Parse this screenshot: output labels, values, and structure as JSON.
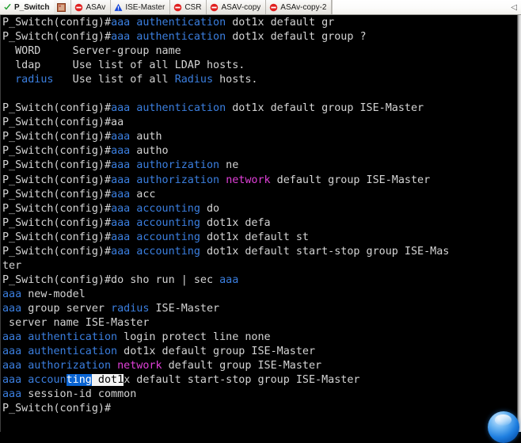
{
  "window": {
    "active_tab": "P_Switch",
    "hostname": "P_Switch",
    "prompt": "P_Switch(config)#"
  },
  "tabs": [
    {
      "label": "P_Switch",
      "icon": "green-check-icon",
      "active": true
    },
    {
      "label": "",
      "icon": "image-thumbnail-icon",
      "active": false
    },
    {
      "label": "ASAv",
      "icon": "red-stop-icon",
      "active": false
    },
    {
      "label": "ISE-Master",
      "icon": "blue-warning-icon",
      "active": false
    },
    {
      "label": "CSR",
      "icon": "red-stop-icon",
      "active": false
    },
    {
      "label": "ASAV-copy",
      "icon": "red-stop-icon",
      "active": false
    },
    {
      "label": "ASAv-copy-2",
      "icon": "red-stop-icon",
      "active": false
    }
  ],
  "tab_overflow_glyph": "◁",
  "colors": {
    "background": "#000000",
    "text": "#d4d4d4",
    "keyword_blue": "#3b7fe0",
    "keyword_magenta": "#e040d8",
    "selection_blue": "#0a64d2",
    "selection_white": "#f2f2f2",
    "tabbar_background": "#eceae6"
  },
  "terminal": {
    "lines": [
      {
        "id": "l01",
        "segs": [
          {
            "t": "P_Switch(config)#",
            "c": "w"
          },
          {
            "t": "aaa authentication",
            "c": "b"
          },
          {
            "t": " dot1x default gr",
            "c": "w"
          }
        ]
      },
      {
        "id": "l02",
        "segs": [
          {
            "t": "P_Switch(config)#",
            "c": "w"
          },
          {
            "t": "aaa authentication",
            "c": "b"
          },
          {
            "t": " dot1x default group ?",
            "c": "w"
          }
        ]
      },
      {
        "id": "l03",
        "segs": [
          {
            "t": "  WORD     Server-group name",
            "c": "w"
          }
        ]
      },
      {
        "id": "l04",
        "segs": [
          {
            "t": "  ldap     Use list of all LDAP hosts.",
            "c": "w"
          }
        ]
      },
      {
        "id": "l05",
        "segs": [
          {
            "t": "  ",
            "c": "w"
          },
          {
            "t": "radius",
            "c": "b"
          },
          {
            "t": "   Use list of all ",
            "c": "w"
          },
          {
            "t": "Radius",
            "c": "b"
          },
          {
            "t": " hosts.",
            "c": "w"
          }
        ]
      },
      {
        "id": "l06",
        "segs": [
          {
            "t": "",
            "c": "w"
          }
        ]
      },
      {
        "id": "l07",
        "segs": [
          {
            "t": "P_Switch(config)#",
            "c": "w"
          },
          {
            "t": "aaa authentication",
            "c": "b"
          },
          {
            "t": " dot1x default group ISE-Master",
            "c": "w"
          }
        ]
      },
      {
        "id": "l08",
        "segs": [
          {
            "t": "P_Switch(config)#aa",
            "c": "w"
          }
        ]
      },
      {
        "id": "l09",
        "segs": [
          {
            "t": "P_Switch(config)#",
            "c": "w"
          },
          {
            "t": "aaa",
            "c": "b"
          },
          {
            "t": " auth",
            "c": "w"
          }
        ]
      },
      {
        "id": "l10",
        "segs": [
          {
            "t": "P_Switch(config)#",
            "c": "w"
          },
          {
            "t": "aaa",
            "c": "b"
          },
          {
            "t": " autho",
            "c": "w"
          }
        ]
      },
      {
        "id": "l11",
        "segs": [
          {
            "t": "P_Switch(config)#",
            "c": "w"
          },
          {
            "t": "aaa authorization",
            "c": "b"
          },
          {
            "t": " ne",
            "c": "w"
          }
        ]
      },
      {
        "id": "l12",
        "segs": [
          {
            "t": "P_Switch(config)#",
            "c": "w"
          },
          {
            "t": "aaa authorization",
            "c": "b"
          },
          {
            "t": " ",
            "c": "w"
          },
          {
            "t": "network",
            "c": "m"
          },
          {
            "t": " default group ISE-Master",
            "c": "w"
          }
        ]
      },
      {
        "id": "l13",
        "segs": [
          {
            "t": "P_Switch(config)#",
            "c": "w"
          },
          {
            "t": "aaa",
            "c": "b"
          },
          {
            "t": " acc",
            "c": "w"
          }
        ]
      },
      {
        "id": "l14",
        "segs": [
          {
            "t": "P_Switch(config)#",
            "c": "w"
          },
          {
            "t": "aaa accounting",
            "c": "b"
          },
          {
            "t": " do",
            "c": "w"
          }
        ]
      },
      {
        "id": "l15",
        "segs": [
          {
            "t": "P_Switch(config)#",
            "c": "w"
          },
          {
            "t": "aaa accounting",
            "c": "b"
          },
          {
            "t": " dot1x defa",
            "c": "w"
          }
        ]
      },
      {
        "id": "l16",
        "segs": [
          {
            "t": "P_Switch(config)#",
            "c": "w"
          },
          {
            "t": "aaa accounting",
            "c": "b"
          },
          {
            "t": " dot1x default st",
            "c": "w"
          }
        ]
      },
      {
        "id": "l17",
        "segs": [
          {
            "t": "P_Switch(config)#",
            "c": "w"
          },
          {
            "t": "aaa accounting",
            "c": "b"
          },
          {
            "t": " dot1x default start-stop group ISE-Mas",
            "c": "w"
          }
        ]
      },
      {
        "id": "l18",
        "segs": [
          {
            "t": "ter",
            "c": "w"
          }
        ]
      },
      {
        "id": "l19",
        "segs": [
          {
            "t": "P_Switch(config)#do sho run | sec ",
            "c": "w"
          },
          {
            "t": "aaa",
            "c": "b"
          }
        ]
      },
      {
        "id": "l20",
        "segs": [
          {
            "t": "aaa",
            "c": "b"
          },
          {
            "t": " new-model",
            "c": "w"
          }
        ]
      },
      {
        "id": "l21",
        "segs": [
          {
            "t": "aaa",
            "c": "b"
          },
          {
            "t": " group server ",
            "c": "w"
          },
          {
            "t": "radius",
            "c": "b"
          },
          {
            "t": " ISE-Master",
            "c": "w"
          }
        ]
      },
      {
        "id": "l22",
        "segs": [
          {
            "t": " server name ISE-Master",
            "c": "w"
          }
        ]
      },
      {
        "id": "l23",
        "segs": [
          {
            "t": "aaa authentication",
            "c": "b"
          },
          {
            "t": " login protect line none",
            "c": "w"
          }
        ]
      },
      {
        "id": "l24",
        "segs": [
          {
            "t": "aaa authentication",
            "c": "b"
          },
          {
            "t": " dot1x default group ISE-Master",
            "c": "w"
          }
        ]
      },
      {
        "id": "l25",
        "segs": [
          {
            "t": "aaa authorization",
            "c": "b"
          },
          {
            "t": " ",
            "c": "w"
          },
          {
            "t": "network",
            "c": "m"
          },
          {
            "t": " default group ISE-Master",
            "c": "w"
          }
        ]
      },
      {
        "id": "l26",
        "segs": [
          {
            "t": "aaa accoun",
            "c": "b"
          },
          {
            "t": "ting",
            "c": "sel-blue"
          },
          {
            "t": " dot1",
            "c": "sel-white"
          },
          {
            "t": "x default start-stop group ISE-Master",
            "c": "w"
          }
        ]
      },
      {
        "id": "l27",
        "segs": [
          {
            "t": "aaa",
            "c": "b"
          },
          {
            "t": " session-id common",
            "c": "w"
          }
        ]
      },
      {
        "id": "l28",
        "segs": [
          {
            "t": "P_Switch(config)#",
            "c": "w"
          }
        ]
      }
    ]
  }
}
